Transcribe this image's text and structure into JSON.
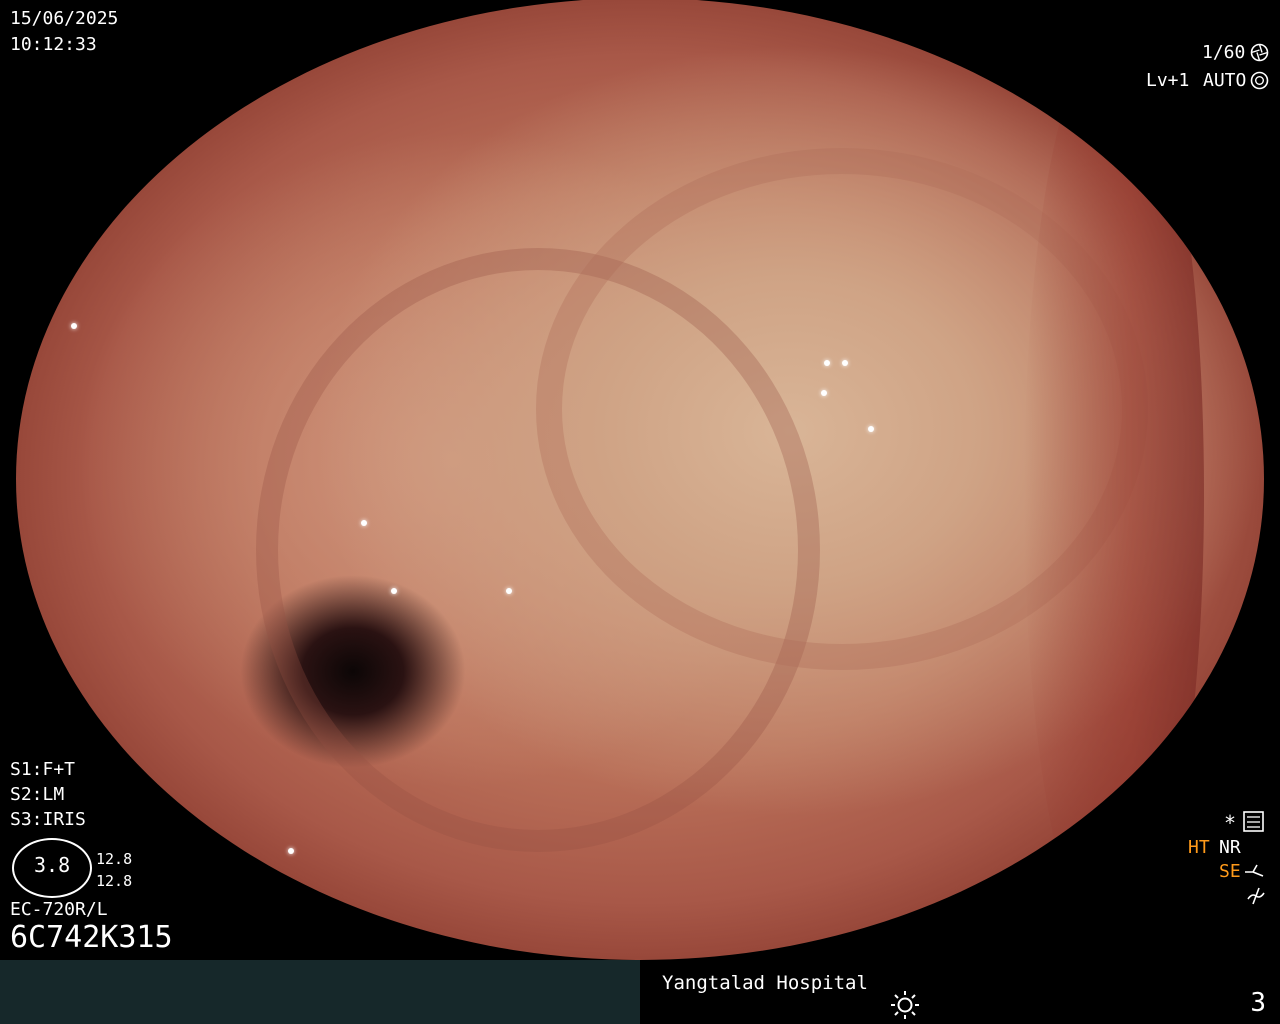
{
  "overlay": {
    "date": "15/06/2025",
    "time": "10:12:33",
    "shutter": "1/60",
    "level": "Lv+1",
    "iris_mode": "AUTO",
    "s1": "S1:F+T",
    "s2": "S2:LM",
    "s3": "S3:IRIS",
    "lens_value": "3.8",
    "lens_top": "12.8",
    "lens_bottom": "12.8",
    "model": "EC-720R/L",
    "serial": "6C742K315",
    "star": "*",
    "ht": "HT",
    "nr": "NR",
    "se": "SE",
    "icon_names": [
      "shutter-icon",
      "auto-iris-icon",
      "settings-icon",
      "brightness-icon",
      "enhance-icon",
      "signal-icon"
    ],
    "colors": {
      "accent": "#ff9a1a",
      "footer_left": "#16282a"
    }
  },
  "footer": {
    "hospital": "Yangtalad Hospital",
    "page": "3"
  }
}
